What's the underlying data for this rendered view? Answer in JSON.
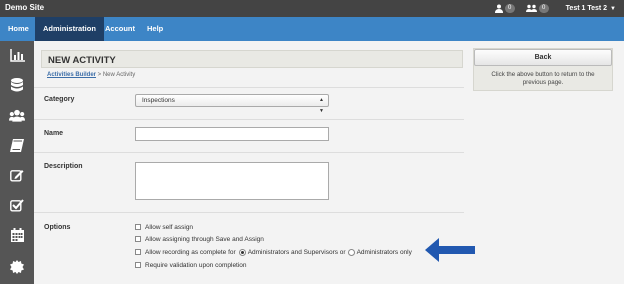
{
  "header": {
    "site_title": "Demo Site",
    "user_badge": "0",
    "group_badge": "0",
    "username": "Test 1 Test 2"
  },
  "nav": {
    "items": [
      {
        "label": "Home"
      },
      {
        "label": "Administration"
      },
      {
        "label": "Account"
      },
      {
        "label": "Help"
      }
    ],
    "active": "Administration"
  },
  "sidebar": {
    "icons": [
      "chart-icon",
      "database-icon",
      "users-icon",
      "book-icon",
      "edit-icon",
      "checklist-icon",
      "calendar-icon",
      "settings-icon"
    ]
  },
  "page": {
    "title": "NEW ACTIVITY",
    "breadcrumb_link": "Activities Builder",
    "breadcrumb_rest": " > New Activity"
  },
  "form": {
    "category_label": "Category",
    "category_value": "Inspections",
    "name_label": "Name",
    "name_value": "",
    "description_label": "Description",
    "description_value": "",
    "options_label": "Options",
    "options": {
      "self_assign": "Allow self assign",
      "save_assign": "Allow assigning through Save and Assign",
      "recording_prefix": "Allow recording as complete for",
      "radio_admins_supervisors": "Administrators and Supervisors or",
      "radio_admins_only": "Administrators only",
      "require_validation": "Require validation upon completion"
    }
  },
  "right_panel": {
    "back_label": "Back",
    "help_text": "Click the above button to return to the previous page."
  },
  "colors": {
    "nav_blue": "#3d85c6",
    "nav_active": "#1f3f66",
    "topbar": "#444444",
    "sidebar": "#555555",
    "arrow_blue": "#2158b0"
  }
}
